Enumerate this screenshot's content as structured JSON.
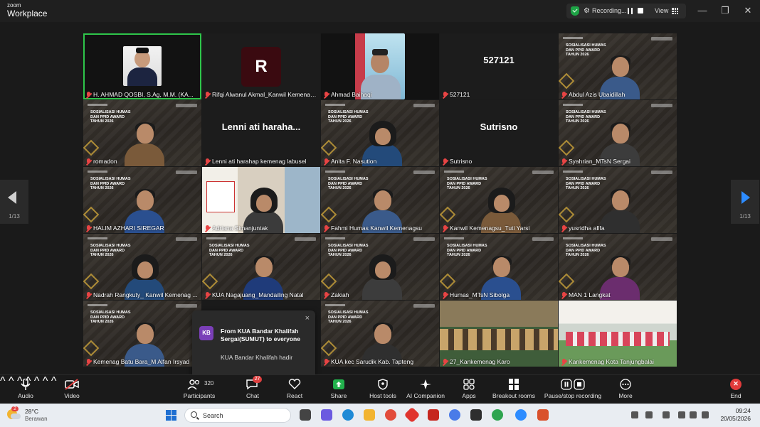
{
  "app": {
    "logo_line1": "zoom",
    "logo_line2": "Workplace"
  },
  "topbar": {
    "recording_label": "Recording...",
    "view_label": "View"
  },
  "window": {
    "minimize": "—",
    "restore": "❐",
    "close": "✕"
  },
  "pagination": {
    "left_page": "1/13",
    "right_page": "1/13"
  },
  "slide": {
    "line1": "SOSIALISASI HUMAS",
    "line2": "DAN PPID AWARD",
    "line3": "TAHUN 2026"
  },
  "tiles": [
    {
      "name": "H. AHMAD QOSBI, S.Ag, M.M. (KA...",
      "type": "photo"
    },
    {
      "name": "Rifqi Alwanul Akmal_Kanwil Kemenagsu",
      "type": "avatar",
      "avatar_letter": "R"
    },
    {
      "name": "Ahmad Baihaqi",
      "type": "photo"
    },
    {
      "name": "527121",
      "type": "text",
      "big": "527121"
    },
    {
      "name": "Abdul Azis Ubaidillah",
      "type": "video"
    },
    {
      "name": "romadon",
      "type": "video"
    },
    {
      "name": "Lenni ati harahap kemenag labusel",
      "type": "text",
      "big": "Lenni ati haraha..."
    },
    {
      "name": "Anita F. Nasution",
      "type": "video"
    },
    {
      "name": "Sutrisno",
      "type": "text",
      "big": "Sutrisno"
    },
    {
      "name": "Syahrian_MTsN Sergai",
      "type": "video"
    },
    {
      "name": "HALIM AZHARI SIREGAR",
      "type": "video"
    },
    {
      "name": "Adriana Simanjuntak",
      "type": "video"
    },
    {
      "name": "Fahmi Humas Kanwil Kemenagsu",
      "type": "video"
    },
    {
      "name": "Kanwil Kemenagsu_Tuti Yarsi",
      "type": "video"
    },
    {
      "name": "yusridha afifa",
      "type": "video"
    },
    {
      "name": "Nadrah Rangkuty_ Kanwil Kemenag ...",
      "type": "video"
    },
    {
      "name": "KUA Nagajuang_Mandailing Natal",
      "type": "video"
    },
    {
      "name": "Zakiah",
      "type": "video"
    },
    {
      "name": "Humas_MTsN Sibolga",
      "type": "video"
    },
    {
      "name": "MAN 1 Langkat",
      "type": "video"
    },
    {
      "name": "Kemenag Batu Bara_M Alfan Irsyad",
      "type": "video"
    },
    {
      "name": "",
      "type": "hidden"
    },
    {
      "name": "KUA kec Sarudik Kab. Tapteng",
      "type": "video"
    },
    {
      "name": "27_Kankemenag Karo",
      "type": "video"
    },
    {
      "name": "Kankemenag Kota Tanjungbalai",
      "type": "video"
    }
  ],
  "chat_popup": {
    "initials": "KB",
    "from": "From KUA Bandar Khalifah Sergai(SUMUT) to everyone",
    "message": "KUA Bandar Khalifah hadir",
    "close": "×"
  },
  "toolbar": {
    "audio": "Audio",
    "video": "Video",
    "participants": "Participants",
    "participants_count": "320",
    "chat": "Chat",
    "chat_badge": "27",
    "react": "React",
    "share": "Share",
    "host_tools": "Host tools",
    "ai_companion": "AI Companion",
    "apps": "Apps",
    "breakout_rooms": "Breakout rooms",
    "pause_stop": "Pause/stop recording",
    "more": "More",
    "end": "End"
  },
  "taskbar": {
    "weather_badge": "2",
    "temperature": "28°C",
    "condition": "Berawan",
    "search_placeholder": "Search",
    "time": "09:24",
    "date": "20/05/2026"
  },
  "colors": {
    "active_speaker": "#2ec54a",
    "end_red": "#e23b3b",
    "record_green": "#1ea446",
    "accent_blue": "#2d8cff"
  }
}
